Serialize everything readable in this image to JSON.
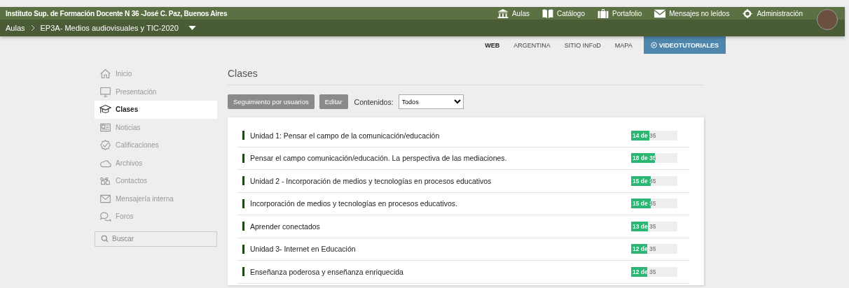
{
  "header": {
    "institution": "Instituto Sup. de Formación Docente N 36 -José C. Paz, Buenos Aires",
    "top_links": [
      {
        "label": "Aulas",
        "kind": "building"
      },
      {
        "label": "Catálogo",
        "kind": "book"
      },
      {
        "label": "Portafolio",
        "kind": "briefcase"
      },
      {
        "label": "Mensajes no leídos",
        "kind": "mail"
      },
      {
        "label": "Administración",
        "kind": "gear"
      }
    ],
    "breadcrumb": [
      "Aulas",
      "EP3A- Medios audiovisuales y TIC-2020"
    ]
  },
  "site_links": [
    {
      "label": "WEB",
      "selected": true,
      "kind": "link"
    },
    {
      "label": "ARGENTINA",
      "selected": false,
      "kind": "link"
    },
    {
      "label": "SITIO INFoD",
      "selected": false,
      "kind": "link"
    },
    {
      "label": "MAPA",
      "selected": false,
      "kind": "link"
    },
    {
      "label": "VIDEOTUTORIALES",
      "selected": false,
      "kind": "video"
    }
  ],
  "sidebar": {
    "items": [
      {
        "label": "Inicio",
        "kind": "home",
        "selected": false
      },
      {
        "label": "Presentación",
        "kind": "monitor",
        "selected": false
      },
      {
        "label": "Clases",
        "kind": "cap",
        "selected": true
      },
      {
        "label": "Noticias",
        "kind": "news",
        "selected": false
      },
      {
        "label": "Calificaciones",
        "kind": "check",
        "selected": false
      },
      {
        "label": "Archivos",
        "kind": "cloud",
        "selected": false
      },
      {
        "label": "Contactos",
        "kind": "people",
        "selected": false
      },
      {
        "label": "Mensajería interna",
        "kind": "mail",
        "selected": false
      },
      {
        "label": "Foros",
        "kind": "chat",
        "selected": false
      }
    ],
    "search": {
      "placeholder": "Buscar"
    }
  },
  "main": {
    "title": "Clases",
    "buttons": [
      "Seguimiento por usuarios",
      "Editar"
    ],
    "filter": {
      "label": "Contenidos:",
      "value": "Todos"
    },
    "classes": [
      {
        "title": "Unidad 1: Pensar el campo de la comunicación/educación",
        "progress": "14 de 35",
        "level": 0.4
      },
      {
        "title": "Pensar el campo comunicación/educación. La perspectiva de las mediaciones.",
        "progress": "18 de 35",
        "level": 0.514
      },
      {
        "title": "Unidad 2 - Incorporación de medios y tecnologías en procesos educativos",
        "progress": "15 de 35",
        "level": 0.429
      },
      {
        "title": "Incorporación de medios y tecnologías en procesos educativos.",
        "progress": "15 de 35",
        "level": 0.429
      },
      {
        "title": "Aprender conectados",
        "progress": "13 de 35",
        "level": 0.371
      },
      {
        "title": "Unidad 3- Internet en Educación",
        "progress": "12 de 35",
        "level": 0.343
      },
      {
        "title": "Enseñanza poderosa y enseñanza enriquecida",
        "progress": "12 de 35",
        "level": 0.343
      }
    ]
  }
}
